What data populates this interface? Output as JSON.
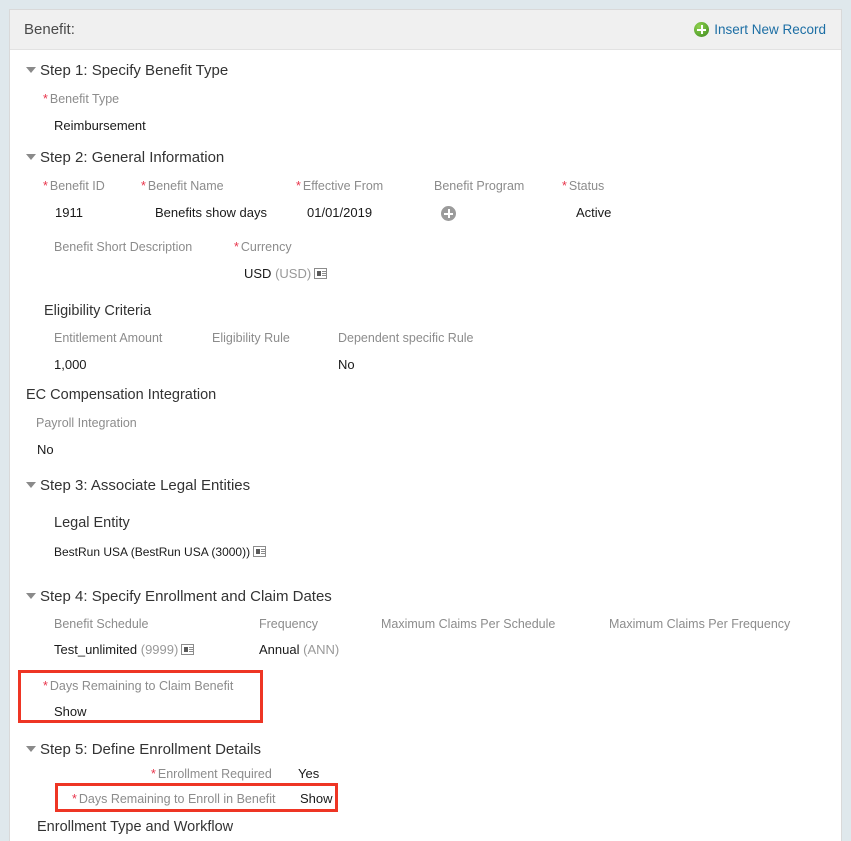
{
  "window": {
    "title": "Benefit:",
    "insert_new_record": "Insert New Record",
    "insert_icon": "plus-circle-green-icon"
  },
  "steps": [
    {
      "id": "step1",
      "title": "Step 1: Specify Benefit Type",
      "fields": [
        {
          "label": "Benefit Type",
          "required": true,
          "value": "Reimbursement"
        }
      ]
    },
    {
      "id": "step2",
      "title": "Step 2: General Information",
      "fields": [
        {
          "label": "Benefit ID",
          "required": true,
          "value": "1911"
        },
        {
          "label": "Benefit Name",
          "required": true,
          "value": "Benefits show days"
        },
        {
          "label": "Effective From",
          "required": true,
          "value": "01/01/2019"
        },
        {
          "label": "Benefit Program",
          "required": false,
          "value": "",
          "icon": "plus-circle-gray-icon"
        },
        {
          "label": "Status",
          "required": true,
          "value": "Active"
        },
        {
          "label": "Benefit Short Description",
          "required": false,
          "value": ""
        },
        {
          "label": "Currency",
          "required": true,
          "value": "USD",
          "code": "(USD)",
          "icon": "value-help-icon"
        }
      ],
      "groups": [
        {
          "title": "Eligibility Criteria",
          "fields": [
            {
              "label": "Entitlement Amount",
              "required": false,
              "value": "1,000"
            },
            {
              "label": "Eligibility Rule",
              "required": false,
              "value": ""
            },
            {
              "label": "Dependent specific Rule",
              "required": false,
              "value": "No"
            }
          ]
        },
        {
          "title": "EC Compensation Integration",
          "fields": [
            {
              "label": "Payroll Integration",
              "required": false,
              "value": "No"
            }
          ]
        }
      ]
    },
    {
      "id": "step3",
      "title": "Step 3: Associate Legal Entities",
      "groups": [
        {
          "title": "Legal Entity",
          "fields": [
            {
              "label": "",
              "required": false,
              "value": "BestRun USA (BestRun USA (3000))",
              "icon": "value-help-icon"
            }
          ]
        }
      ]
    },
    {
      "id": "step4",
      "title": "Step 4: Specify Enrollment and Claim Dates",
      "fields": [
        {
          "label": "Benefit Schedule",
          "required": false,
          "value": "Test_unlimited",
          "code": "(9999)",
          "icon": "value-help-icon"
        },
        {
          "label": "Frequency",
          "required": false,
          "value": "Annual",
          "code": "(ANN)"
        },
        {
          "label": "Maximum Claims Per Schedule",
          "required": false,
          "value": ""
        },
        {
          "label": "Maximum Claims Per Frequency",
          "required": false,
          "value": ""
        },
        {
          "label": "Days Remaining to Claim Benefit",
          "required": true,
          "value": "Show",
          "highlighted": true
        }
      ]
    },
    {
      "id": "step5",
      "title": "Step 5: Define Enrollment Details",
      "fields": [
        {
          "label": "Enrollment Required",
          "required": true,
          "value": "Yes"
        },
        {
          "label": "Days Remaining to Enroll in Benefit",
          "required": true,
          "value": "Show",
          "highlighted": true
        }
      ],
      "groups": [
        {
          "title": "Enrollment Type and Workflow",
          "fields": []
        }
      ]
    }
  ],
  "highlights": [
    {
      "name": "days-remaining-to-claim-benefit",
      "color": "#ee3524"
    },
    {
      "name": "days-remaining-to-enroll-in-benefit",
      "color": "#ee3524"
    }
  ],
  "colors": {
    "page_background": "#dfe8ec",
    "card_background": "#ffffff",
    "titlebar_background": "#f0f0f0",
    "link": "#1c6ea4",
    "required_asterisk": "#e8334a",
    "label": "#8c8c8c",
    "value": "#1a1a1a",
    "highlight": "#ee3524"
  }
}
